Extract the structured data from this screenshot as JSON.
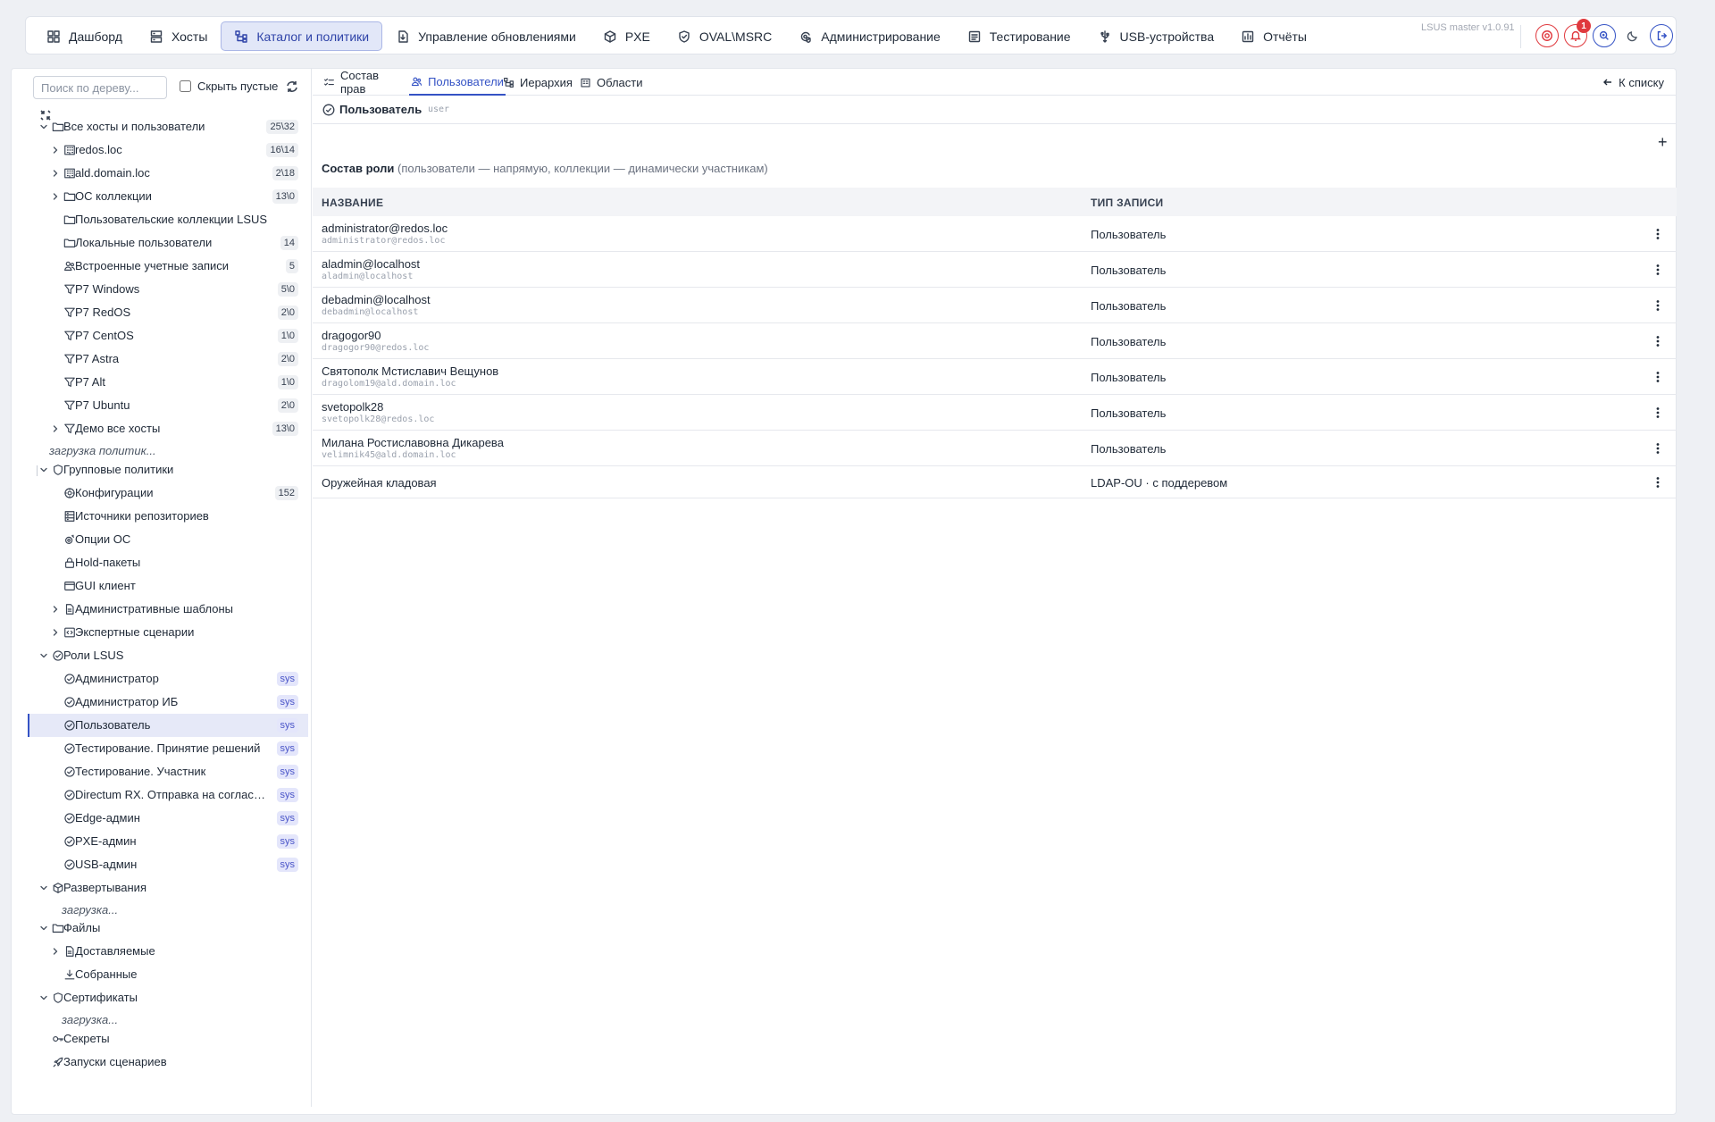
{
  "nav": {
    "items": [
      {
        "label": "Дашборд",
        "icon": "dashboard-icon"
      },
      {
        "label": "Хосты",
        "icon": "servers-icon"
      },
      {
        "label": "Каталог и политики",
        "icon": "hierarchy-icon",
        "active": true
      },
      {
        "label": "Управление обновлениями",
        "icon": "package-update-icon"
      },
      {
        "label": "PXE",
        "icon": "cube-icon"
      },
      {
        "label": "OVAL\\MSRC",
        "icon": "shield-check-icon"
      },
      {
        "label": "Администрирование",
        "icon": "settings-shield-icon"
      },
      {
        "label": "Тестирование",
        "icon": "checklist-icon"
      },
      {
        "label": "USB-устройства",
        "icon": "usb-icon"
      },
      {
        "label": "Отчёты",
        "icon": "report-icon"
      }
    ],
    "version": "LSUS master v1.0.91",
    "notifications_count": "1"
  },
  "sidebar": {
    "search_placeholder": "Поиск по дереву...",
    "hide_empty_label": "Скрыть пустые",
    "hide_empty_checked": false,
    "tree": [
      {
        "label": "Все хосты и пользователи",
        "icon": "folder-icon",
        "level": 0,
        "expand": "open",
        "badge": "25\\32"
      },
      {
        "label": "redos.loc",
        "icon": "domain-icon",
        "level": 1,
        "expand": "closed",
        "badge": "16\\14"
      },
      {
        "label": "ald.domain.loc",
        "icon": "domain-icon",
        "level": 1,
        "expand": "closed",
        "badge": "2\\18"
      },
      {
        "label": "ОС коллекции",
        "icon": "folder-icon",
        "level": 1,
        "expand": "closed",
        "badge": "13\\0"
      },
      {
        "label": "Пользовательские коллекции LSUS",
        "icon": "folder-icon",
        "level": 1,
        "expand": "none"
      },
      {
        "label": "Локальные пользователи",
        "icon": "folder-icon",
        "level": 1,
        "expand": "none",
        "badge": "14"
      },
      {
        "label": "Встроенные учетные записи",
        "icon": "users-icon",
        "level": 1,
        "expand": "none",
        "badge": "5"
      },
      {
        "label": "P7 Windows",
        "icon": "filter-icon",
        "level": 1,
        "expand": "none",
        "badge": "5\\0"
      },
      {
        "label": "P7 RedOS",
        "icon": "filter-icon",
        "level": 1,
        "expand": "none",
        "badge": "2\\0"
      },
      {
        "label": "P7 CentOS",
        "icon": "filter-icon",
        "level": 1,
        "expand": "none",
        "badge": "1\\0"
      },
      {
        "label": "P7 Astra",
        "icon": "filter-icon",
        "level": 1,
        "expand": "none",
        "badge": "2\\0"
      },
      {
        "label": "P7 Alt",
        "icon": "filter-icon",
        "level": 1,
        "expand": "none",
        "badge": "1\\0"
      },
      {
        "label": "P7 Ubuntu",
        "icon": "filter-icon",
        "level": 1,
        "expand": "none",
        "badge": "2\\0"
      },
      {
        "label": "Демо все хосты",
        "icon": "filter-icon",
        "level": 1,
        "expand": "closed",
        "badge": "13\\0"
      },
      {
        "loading": "загрузка политик..."
      },
      {
        "label": "Групповые политики",
        "icon": "shield-icon",
        "level": 0,
        "expand": "open"
      },
      {
        "label": "Конфигурации",
        "icon": "settings-icon",
        "level": 1,
        "expand": "none",
        "badge": "152"
      },
      {
        "label": "Источники репозиториев",
        "icon": "server-icon",
        "level": 1,
        "expand": "none"
      },
      {
        "label": "Опции ОС",
        "icon": "gear-icon",
        "level": 1,
        "expand": "none"
      },
      {
        "label": "Hold-пакеты",
        "icon": "lock-icon",
        "level": 1,
        "expand": "none"
      },
      {
        "label": "GUI клиент",
        "icon": "window-icon",
        "level": 1,
        "expand": "none"
      },
      {
        "label": "Административные шаблоны",
        "icon": "document-icon",
        "level": 1,
        "expand": "closed"
      },
      {
        "label": "Экспертные сценарии",
        "icon": "code-icon",
        "level": 1,
        "expand": "closed"
      },
      {
        "label": "Роли LSUS",
        "icon": "role-icon",
        "level": 0,
        "expand": "open"
      },
      {
        "label": "Администратор",
        "icon": "role-icon",
        "level": 1,
        "expand": "none",
        "badge": "sys"
      },
      {
        "label": "Администратор ИБ",
        "icon": "role-icon",
        "level": 1,
        "expand": "none",
        "badge": "sys"
      },
      {
        "label": "Пользователь",
        "icon": "role-icon",
        "level": 1,
        "expand": "none",
        "badge": "sys",
        "selected": true
      },
      {
        "label": "Тестирование. Принятие решений",
        "icon": "role-icon",
        "level": 1,
        "expand": "none",
        "badge": "sys"
      },
      {
        "label": "Тестирование. Участник",
        "icon": "role-icon",
        "level": 1,
        "expand": "none",
        "badge": "sys"
      },
      {
        "label": "Directum RX. Отправка на согласов...",
        "icon": "role-icon",
        "level": 1,
        "expand": "none",
        "badge": "sys"
      },
      {
        "label": "Edge-админ",
        "icon": "role-icon",
        "level": 1,
        "expand": "none",
        "badge": "sys"
      },
      {
        "label": "PXE-админ",
        "icon": "role-icon",
        "level": 1,
        "expand": "none",
        "badge": "sys"
      },
      {
        "label": "USB-админ",
        "icon": "role-icon",
        "level": 1,
        "expand": "none",
        "badge": "sys"
      },
      {
        "label": "Развертывания",
        "icon": "cube-icon",
        "level": 0,
        "expand": "open"
      },
      {
        "loading": "загрузка..."
      },
      {
        "label": "Файлы",
        "icon": "folder-icon",
        "level": 0,
        "expand": "open"
      },
      {
        "label": "Доставляемые",
        "icon": "document-icon",
        "level": 1,
        "expand": "closed"
      },
      {
        "label": "Собранные",
        "icon": "download-icon",
        "level": 1,
        "expand": "none"
      },
      {
        "label": "Сертификаты",
        "icon": "shield-icon",
        "level": 0,
        "expand": "open"
      },
      {
        "loading": "загрузка..."
      },
      {
        "label": "Секреты",
        "icon": "key-icon",
        "level": 0,
        "expand": "none"
      },
      {
        "label": "Запуски сценариев",
        "icon": "rocket-icon",
        "level": 0,
        "expand": "none"
      }
    ]
  },
  "content": {
    "tabs": [
      {
        "label": "Состав прав",
        "icon": "list-check-icon"
      },
      {
        "label": "Пользователи",
        "icon": "users-icon",
        "active": true
      },
      {
        "label": "Иерархия",
        "icon": "hierarchy-icon"
      },
      {
        "label": "Области",
        "icon": "building-icon"
      }
    ],
    "back_label": "К списку",
    "role_name": "Пользователь",
    "role_code": "user",
    "add_label": "+",
    "section_title": "Состав роли",
    "section_hint": "(пользователи — напрямую, коллекции — динамически участникам)",
    "columns": {
      "name": "НАЗВАНИЕ",
      "type": "ТИП ЗАПИСИ"
    },
    "rows": [
      {
        "name": "administrator@redos.loc",
        "sub": "administrator@redos.loc",
        "type": "Пользователь"
      },
      {
        "name": "aladmin@localhost",
        "sub": "aladmin@localhost",
        "type": "Пользователь"
      },
      {
        "name": "debadmin@localhost",
        "sub": "debadmin@localhost",
        "type": "Пользователь"
      },
      {
        "name": "dragogor90",
        "sub": "dragogor90@redos.loc",
        "type": "Пользователь"
      },
      {
        "name": "Святополк Мстиславич Вещунов",
        "sub": "dragolom19@ald.domain.loc",
        "type": "Пользователь"
      },
      {
        "name": "svetopolk28",
        "sub": "svetopolk28@redos.loc",
        "type": "Пользователь"
      },
      {
        "name": "Милана Ростиславовна Дикарева",
        "sub": "velimnik45@ald.domain.loc",
        "type": "Пользователь"
      },
      {
        "name": "Оружейная кладовая",
        "sub": "",
        "type": "LDAP-OU · с поддеревом"
      }
    ]
  },
  "colors": {
    "accent": "#3553c5",
    "active_bg": "#e2e7f8",
    "danger": "#e0393e",
    "sys_badge_bg": "#e4e6fb"
  }
}
